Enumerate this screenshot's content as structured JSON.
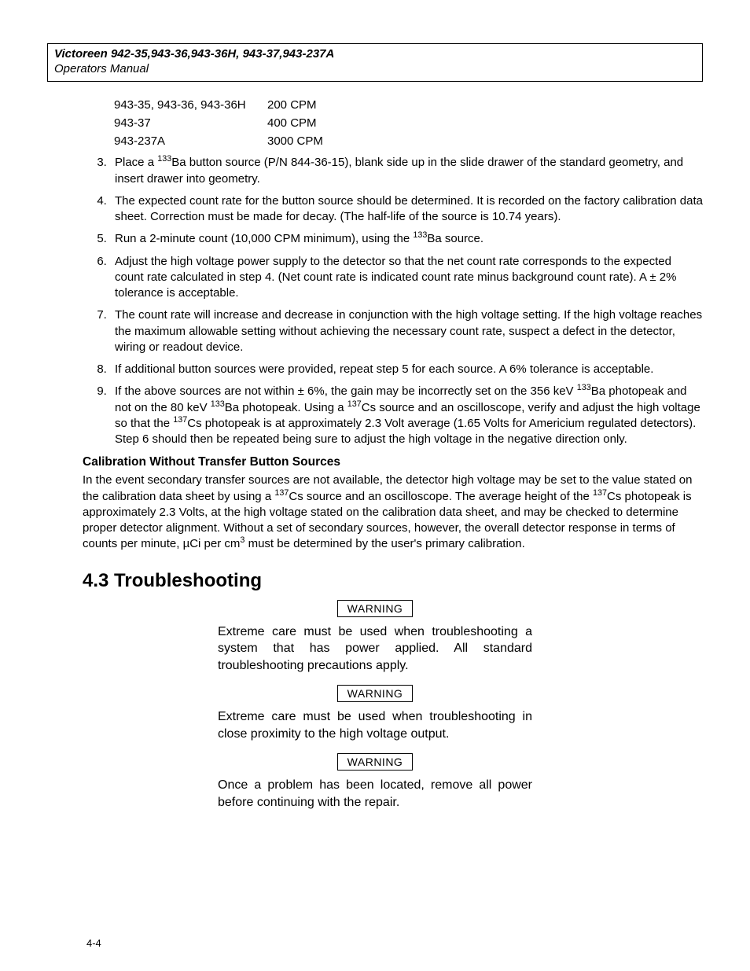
{
  "header": {
    "title": "Victoreen 942-35,943-36,943-36H, 943-37,943-237A",
    "subtitle": "Operators Manual"
  },
  "cpm_table": [
    {
      "model": "943-35, 943-36, 943-36H",
      "cpm": "200 CPM"
    },
    {
      "model": "943-37",
      "cpm": "400 CPM"
    },
    {
      "model": "943-237A",
      "cpm": "3000 CPM"
    }
  ],
  "steps": {
    "s3a": "Place a ",
    "s3b": "Ba button source (P/N 844-36-15), blank side up in the slide drawer of the standard geometry, and insert drawer into geometry.",
    "s4": "The expected count rate for the button source should be determined. It is recorded on the factory calibration data sheet. Correction must be made for decay. (The half-life of the source is 10.74 years).",
    "s5a": "Run a 2-minute count (10,000 CPM minimum), using the ",
    "s5b": "Ba source.",
    "s6": "Adjust the high voltage power supply to the detector so that the net count rate corresponds to the expected count rate calculated in step 4. (Net count rate is indicated count rate minus background count rate). A ± 2% tolerance is acceptable.",
    "s7": "The count rate will increase and decrease in conjunction with the high voltage setting. If the high voltage reaches the maximum allowable setting without achieving the necessary count rate, suspect a defect in the detector, wiring or readout device.",
    "s8": "If additional button sources were provided, repeat step 5 for each source. A 6% tolerance is acceptable.",
    "s9a": "If the above sources are not within ± 6%, the gain may be incorrectly set on the 356 keV ",
    "s9b": "Ba photopeak and not on the 80 keV ",
    "s9c": "Ba photopeak. Using a ",
    "s9d": "Cs source and an oscilloscope, verify and adjust the high voltage so that the ",
    "s9e": "Cs photopeak is at approximately 2.3 Volt average (1.65 Volts for Americium regulated detectors). Step 6 should then be repeated being sure to adjust the high voltage in the negative direction only."
  },
  "iso": {
    "ba": "133",
    "cs": "137"
  },
  "calib": {
    "heading": "Calibration Without Transfer Button Sources",
    "p1a": "In the event secondary transfer sources are not available, the detector high voltage may be set to the value stated on the calibration data sheet by using a ",
    "p1b": "Cs source and an oscilloscope. The average height of the ",
    "p1c": "Cs photopeak is approximately 2.3 Volts, at the high voltage stated on the calibration data sheet, and may be checked to determine proper detector alignment. Without a set of secondary sources, however, the overall detector response in terms of counts per minute, µCi per cm",
    "p1d": " must be determined by the user's primary calibration.",
    "cubed": "3"
  },
  "section": {
    "title": "4.3 Troubleshooting"
  },
  "warnings": {
    "label": "WARNING",
    "w1": "Extreme care must be used when troubleshooting a system that has power applied. All standard troubleshooting precautions apply.",
    "w2": "Extreme care must be used when troubleshooting in close proximity to the high voltage output.",
    "w3": "Once a problem has been located, remove all power before continuing with the repair."
  },
  "pagenum": "4-4"
}
